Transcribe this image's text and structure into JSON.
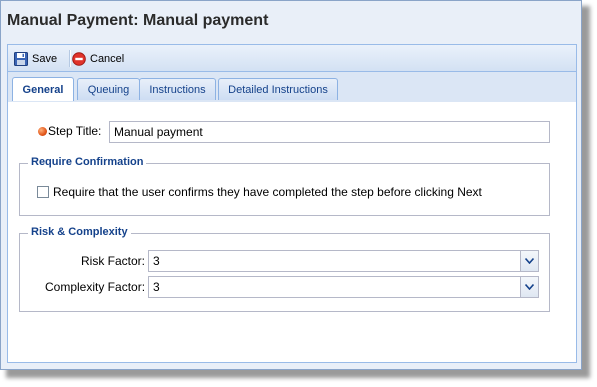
{
  "window": {
    "title": "Manual Payment: Manual payment"
  },
  "toolbar": {
    "save_label": "Save",
    "cancel_label": "Cancel"
  },
  "tabs": [
    {
      "label": "General",
      "active": true
    },
    {
      "label": "Queuing",
      "active": false
    },
    {
      "label": "Instructions",
      "active": false
    },
    {
      "label": "Detailed Instructions",
      "active": false
    }
  ],
  "general": {
    "step_title_label": "Step Title:",
    "step_title_value": "Manual payment"
  },
  "confirmation": {
    "legend": "Require Confirmation",
    "checkbox_label": "Require that the user confirms they have completed the step before clicking Next",
    "checked": false
  },
  "risk": {
    "legend": "Risk & Complexity",
    "risk_label": "Risk Factor:",
    "risk_value": "3",
    "complexity_label": "Complexity Factor:",
    "complexity_value": "3"
  },
  "colors": {
    "accent": "#15428b",
    "required": "#e2561a",
    "border": "#99bbe8"
  }
}
